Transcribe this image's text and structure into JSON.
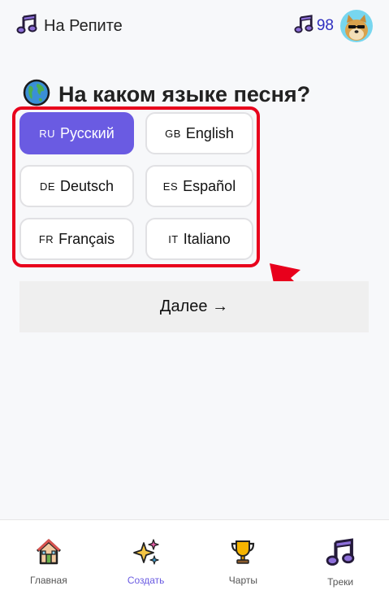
{
  "header": {
    "brand_title": "На Репите",
    "points": "98"
  },
  "question": {
    "text": "На каком языке песня?"
  },
  "languages": [
    {
      "code": "RU",
      "label": "Русский",
      "selected": true
    },
    {
      "code": "GB",
      "label": "English",
      "selected": false
    },
    {
      "code": "DE",
      "label": "Deutsch",
      "selected": false
    },
    {
      "code": "ES",
      "label": "Español",
      "selected": false
    },
    {
      "code": "FR",
      "label": "Français",
      "selected": false
    },
    {
      "code": "IT",
      "label": "Italiano",
      "selected": false
    }
  ],
  "next_button": {
    "label": "Далее →"
  },
  "bottom_nav": {
    "items": [
      {
        "label": "Главная",
        "icon": "house-icon"
      },
      {
        "label": "Создать",
        "icon": "sparkles-icon"
      },
      {
        "label": "Чарты",
        "icon": "trophy-icon"
      },
      {
        "label": "Треки",
        "icon": "music-note-icon"
      }
    ],
    "active_index": 1
  },
  "colors": {
    "accent": "#6a5be2",
    "highlight": "#e8001c",
    "points_text": "#2f2fc0"
  }
}
